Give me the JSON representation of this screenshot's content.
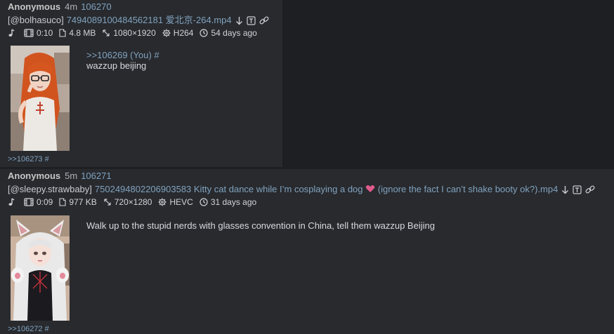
{
  "posts": [
    {
      "name": "Anonymous",
      "time": "4m",
      "id": "106270",
      "uploader": "[@bolhasuco]",
      "filename": "7494089100484562181 爱北京-264.mp4",
      "meta": {
        "duration": "0:10",
        "size": "4.8 MB",
        "resolution": "1080×1920",
        "codec": "H264",
        "age": "54 days ago"
      },
      "quote": ">>106269 (You) #",
      "text": "wazzup beijing",
      "backlink": ">>106273 #"
    },
    {
      "name": "Anonymous",
      "time": "5m",
      "id": "106271",
      "uploader": "[@sleepy.strawbaby]",
      "filename_pre": "7502494802206903583 Kitty cat dance while I’m cosplaying a dog",
      "filename_post": "(ignore the fact I can’t shake booty ok?).mp4",
      "meta": {
        "duration": "0:09",
        "size": "977 KB",
        "resolution": "720×1280",
        "codec": "HEVC",
        "age": "31 days ago"
      },
      "text": "Walk up to the stupid nerds with glasses convention in China, tell them wazzup Beijing",
      "backlink": ">>106272 #"
    }
  ],
  "icons": {
    "audio": "music-note-icon",
    "video": "film-icon",
    "file": "file-icon",
    "resolution": "resize-arrows-icon",
    "codec": "gear-icon",
    "age": "clock-icon",
    "download": "download-arrow-icon",
    "text": "text-box-icon",
    "link": "link-icon"
  },
  "colors": {
    "post_bg": "#282a2e",
    "page_bg": "#1e1f22",
    "link": "#81a2be",
    "heart": "#e05b8b"
  }
}
